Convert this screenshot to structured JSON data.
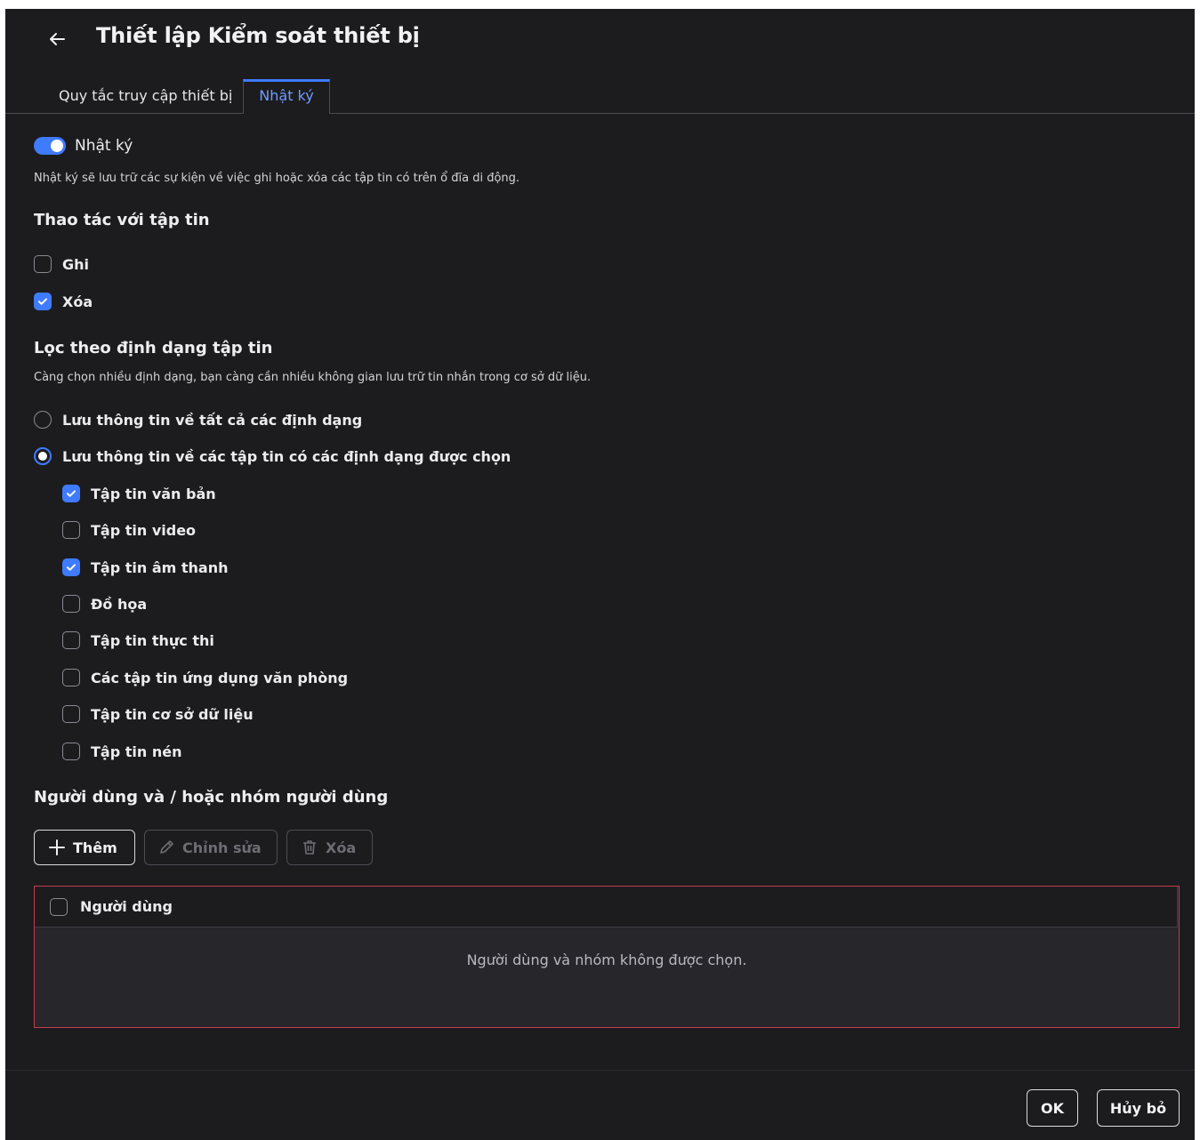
{
  "header": {
    "title": "Thiết lập Kiểm soát thiết bị",
    "back_icon": "arrow-left-icon"
  },
  "tabs": [
    {
      "label": "Quy tắc truy cập thiết bị",
      "active": false
    },
    {
      "label": "Nhật ký",
      "active": true
    }
  ],
  "logging": {
    "toggle_label": "Nhật ký",
    "toggle_on": true,
    "description": "Nhật ký sẽ lưu trữ các sự kiện về việc ghi hoặc xóa các tập tin có trên ổ đĩa di động."
  },
  "file_ops": {
    "title": "Thao tác với tập tin",
    "items": [
      {
        "label": "Ghi",
        "checked": false
      },
      {
        "label": "Xóa",
        "checked": true
      }
    ]
  },
  "format_filter": {
    "title": "Lọc theo định dạng tập tin",
    "description": "Càng chọn nhiều định dạng, bạn càng cần nhiều không gian lưu trữ tin nhắn trong cơ sở dữ liệu.",
    "radios": [
      {
        "label": "Lưu thông tin về tất cả các định dạng",
        "selected": false
      },
      {
        "label": "Lưu thông tin về các tập tin có các định dạng được chọn",
        "selected": true
      }
    ],
    "formats": [
      {
        "label": "Tập tin văn bản",
        "checked": true
      },
      {
        "label": "Tập tin video",
        "checked": false
      },
      {
        "label": "Tập tin âm thanh",
        "checked": true
      },
      {
        "label": "Đồ họa",
        "checked": false
      },
      {
        "label": "Tập tin thực thi",
        "checked": false
      },
      {
        "label": "Các tập tin ứng dụng văn phòng",
        "checked": false
      },
      {
        "label": "Tập tin cơ sở dữ liệu",
        "checked": false
      },
      {
        "label": "Tập tin nén",
        "checked": false
      }
    ]
  },
  "users": {
    "title": "Người dùng và / hoặc nhóm người dùng",
    "buttons": {
      "add": "Thêm",
      "edit": "Chỉnh sửa",
      "delete": "Xóa"
    },
    "table": {
      "column": "Người dùng",
      "empty": "Người dùng và nhóm không được chọn."
    }
  },
  "footer": {
    "ok": "OK",
    "cancel": "Hủy bỏ"
  },
  "colors": {
    "accent": "#3f7bff",
    "error_border": "#c43b4c",
    "background": "#1c1c1f"
  }
}
